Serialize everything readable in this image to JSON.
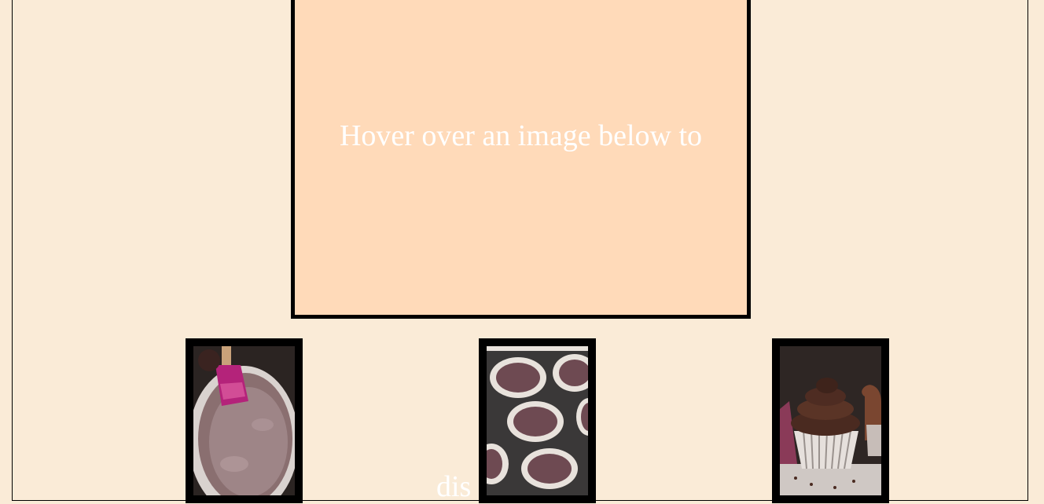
{
  "display": {
    "text": "Hover over an image below to",
    "overflow_text": "dis",
    "background": "#ffdab9",
    "text_color": "#ffffff"
  },
  "page": {
    "background": "#faebd7"
  },
  "gallery": [
    {
      "name": "batter-bowl",
      "description": ""
    },
    {
      "name": "batter-in-cupcake-pan",
      "description": ""
    },
    {
      "name": "frosted-chocolate-cupcake",
      "description": ""
    }
  ]
}
